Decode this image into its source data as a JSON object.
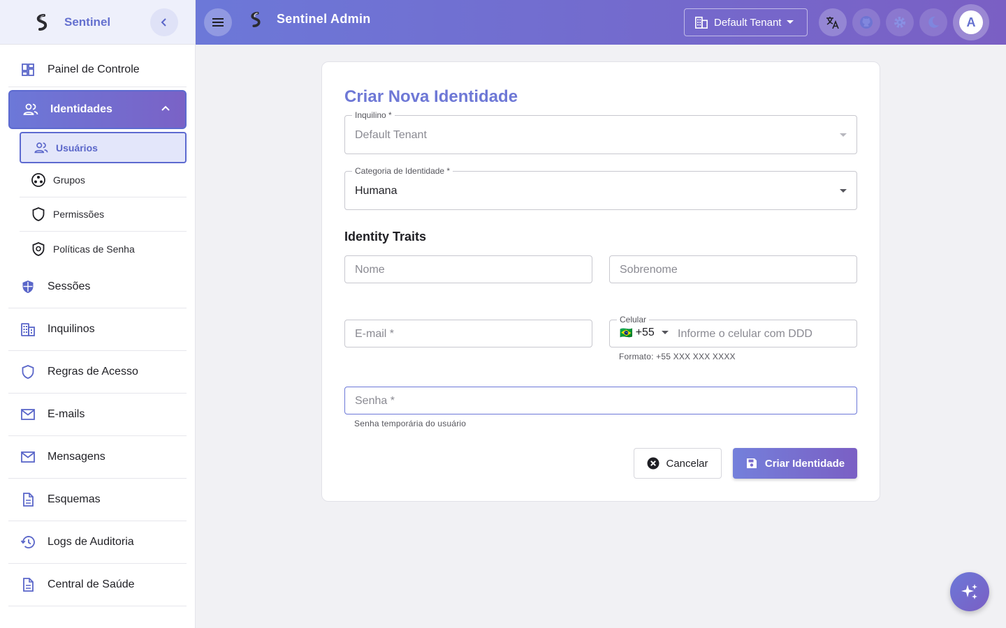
{
  "sidebar": {
    "brand": "Sentinel",
    "items_top": [
      {
        "label": "Painel de Controle",
        "icon": "dashboard-icon"
      }
    ],
    "group": {
      "label": "Identidades",
      "icon": "people-icon",
      "expanded": true
    },
    "sub_items": [
      {
        "label": "Usuários",
        "icon": "people-icon",
        "active": true
      },
      {
        "label": "Grupos",
        "icon": "groups-icon"
      },
      {
        "label": "Permissões",
        "icon": "shield-outline-icon"
      },
      {
        "label": "Políticas de Senha",
        "icon": "password-policy-icon"
      }
    ],
    "items_bottom": [
      {
        "label": "Sessões",
        "icon": "shield-half-icon"
      },
      {
        "label": "Inquilinos",
        "icon": "building-icon"
      },
      {
        "label": "Regras de Acesso",
        "icon": "shield-outline-icon"
      },
      {
        "label": "E-mails",
        "icon": "mail-icon"
      },
      {
        "label": "Mensagens",
        "icon": "mail-icon"
      },
      {
        "label": "Esquemas",
        "icon": "document-icon"
      },
      {
        "label": "Logs de Auditoria",
        "icon": "history-icon"
      },
      {
        "label": "Central de Saúde",
        "icon": "document-icon"
      }
    ]
  },
  "topbar": {
    "title": "Sentinel Admin",
    "tenant": "Default Tenant",
    "avatar_letter": "A"
  },
  "form": {
    "title": "Criar Nova Identidade",
    "tenant_label": "Inquilino *",
    "tenant_value": "Default Tenant",
    "category_label": "Categoria de Identidade *",
    "category_value": "Humana",
    "section_title": "Identity Traits",
    "first_name_placeholder": "Nome",
    "last_name_placeholder": "Sobrenome",
    "email_placeholder": "E-mail *",
    "phone_label": "Celular",
    "phone_country_flag": "🇧🇷",
    "phone_code": "+55",
    "phone_placeholder": "Informe o celular com DDD",
    "phone_helper": "Formato: +55 XXX XXX XXXX",
    "password_placeholder": "Senha *",
    "password_helper": "Senha temporária do usuário",
    "cancel_label": "Cancelar",
    "create_label": "Criar Identidade"
  },
  "colors": {
    "accent": "#6c78d8",
    "accent_end": "#7a5fc4"
  }
}
